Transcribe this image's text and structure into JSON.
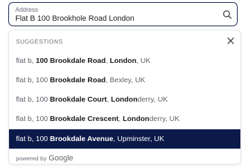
{
  "address_field": {
    "label": "Address",
    "value": "Flat B 100 Brookhole Road London"
  },
  "icons": {
    "search": "search-icon",
    "close": "close-icon"
  },
  "suggestions_panel": {
    "title": "SUGGESTIONS",
    "items": [
      {
        "parts": [
          "flat b, ",
          "100 Brookdale Road",
          ", ",
          "London",
          ", UK"
        ]
      },
      {
        "parts": [
          "flat b, 100 ",
          "Brookdale Road",
          ", Bexley, UK"
        ]
      },
      {
        "parts": [
          "flat b, 100 ",
          "Brookdale Court",
          ", ",
          "London",
          "derry, UK"
        ]
      },
      {
        "parts": [
          "flat b, 100 ",
          "Brookdale Crescent",
          ", ",
          "London",
          "derry, UK"
        ]
      },
      {
        "parts": [
          "flat b, 100 ",
          "Brookdale Avenue",
          ", Upminster, UK"
        ]
      }
    ],
    "active_index": 4,
    "footer_prefix": "powered by",
    "footer_brand": "Google"
  },
  "colors": {
    "active_background": "#0c1a4a",
    "input_border": "#0f1b45"
  }
}
